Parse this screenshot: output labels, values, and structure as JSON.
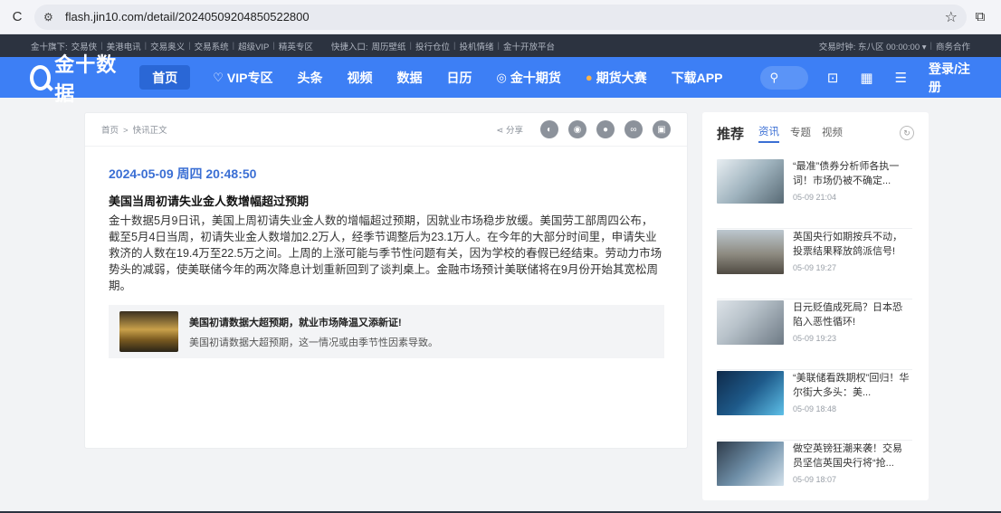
{
  "browser": {
    "url": "flash.jin10.com/detail/20240509204850522800"
  },
  "top_bar": {
    "left_items": [
      "金十旗下:",
      "交易侠",
      "美港电讯",
      "交易奥义",
      "交易系统",
      "超级VIP",
      "精英专区"
    ],
    "quick_label": "快捷入口:",
    "quick_items": [
      "周历壁纸",
      "投行仓位",
      "投机情绪",
      "金十开放平台"
    ],
    "time_label": "交易时钟: 东八区 00:00:00 ▾",
    "business": "商务合作"
  },
  "nav": {
    "logo_text": "金十数据",
    "items": [
      {
        "label": "首页",
        "icon": ""
      },
      {
        "label": "VIP专区",
        "icon": "vip-icon"
      },
      {
        "label": "头条",
        "icon": ""
      },
      {
        "label": "视频",
        "icon": ""
      },
      {
        "label": "数据",
        "icon": ""
      },
      {
        "label": "日历",
        "icon": ""
      },
      {
        "label": "金十期货",
        "icon": "futures-icon"
      },
      {
        "label": "期货大赛",
        "icon": "contest-icon"
      },
      {
        "label": "下载APP",
        "icon": ""
      }
    ],
    "login": "登录/注册"
  },
  "article": {
    "breadcrumb_home": "首页",
    "breadcrumb_sep": ">",
    "breadcrumb_current": "快讯正文",
    "share_label": "分享",
    "time": "2024-05-09 周四 20:48:50",
    "title": "美国当周初请失业金人数增幅超过预期",
    "body": "金十数据5月9日讯，美国上周初请失业金人数的增幅超过预期，因就业市场稳步放缓。美国劳工部周四公布，截至5月4日当周，初请失业金人数增加2.2万人，经季节调整后为23.1万人。在今年的大部分时间里，申请失业救济的人数在19.4万至22.5万之间。上周的上涨可能与季节性问题有关，因为学校的春假已经结束。劳动力市场势头的减弱，使美联储今年的两次降息计划重新回到了谈判桌上。金融市场预计美联储将在9月份开始其宽松周期。",
    "related": {
      "title": "美国初请数据大超预期，就业市场降温又添新证!",
      "desc": "美国初请数据大超预期，这一情况或由季节性因素导致。"
    }
  },
  "sidebar": {
    "title": "推荐",
    "tabs": [
      "资讯",
      "专题",
      "视频"
    ],
    "news": [
      {
        "title": "“最准”债券分析师各执一词！市场仍被不确定...",
        "time": "05-09 21:04"
      },
      {
        "title": "英国央行如期按兵不动，投票结果释放鸽派信号!",
        "time": "05-09 19:27"
      },
      {
        "title": "日元贬值成死局？日本恐陷入恶性循环!",
        "time": "05-09 19:23"
      },
      {
        "title": "“美联储看跌期权”回归！华尔街大多头：美...",
        "time": "05-09 18:48"
      },
      {
        "title": "做空英镑狂潮来袭！交易员坚信英国央行将“抢...",
        "time": "05-09 18:07"
      }
    ]
  }
}
